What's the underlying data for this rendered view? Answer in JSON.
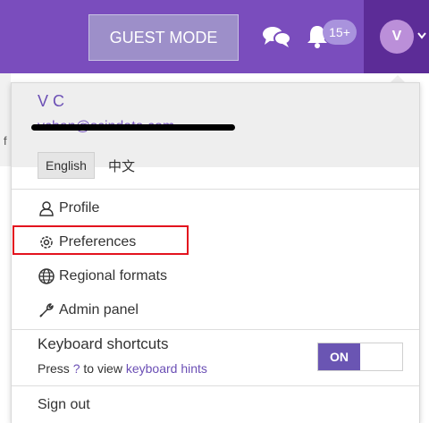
{
  "topbar": {
    "guest_mode_label": "GUEST MODE",
    "chat_icon": "chat-bubbles-icon",
    "bell_icon": "bell-icon",
    "notification_count": "15+",
    "avatar_initial": "V",
    "colors": {
      "bar": "#7a4dbd",
      "avatar_zone": "#5c2c97",
      "avatar": "#bb8fd9"
    }
  },
  "background": {
    "left_char": "f"
  },
  "menu": {
    "user_name": "V C",
    "user_email": "vchan@scindata.com",
    "languages": [
      "English",
      "中文"
    ],
    "items": [
      {
        "label": "Profile",
        "icon": "person-icon"
      },
      {
        "label": "Preferences",
        "icon": "gear-icon"
      },
      {
        "label": "Regional formats",
        "icon": "globe-icon"
      },
      {
        "label": "Admin panel",
        "icon": "wrench-icon"
      }
    ],
    "keyboard": {
      "title": "Keyboard shortcuts",
      "hint_prefix": "Press",
      "hint_key": "?",
      "hint_middle": "to view",
      "hint_link": "keyboard hints",
      "toggle_label": "ON"
    },
    "sign_out": "Sign out",
    "accent": "#6b4fb5",
    "highlight_color": "#e3131e"
  }
}
